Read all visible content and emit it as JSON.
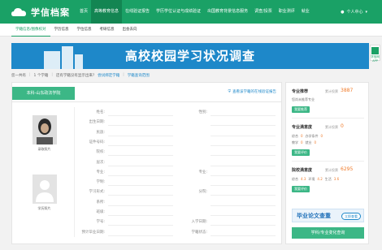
{
  "header": {
    "title": "学信档案",
    "nav": [
      "首页",
      "高等教育信息",
      "在线验证报告",
      "学历学位认证与成绩验证",
      "出国教育背景信息服务",
      "调查/投票",
      "职业测评",
      "就业"
    ],
    "active_index": 1,
    "user_label": "个人中心"
  },
  "subnav": {
    "items": [
      "学籍信息/图像校对",
      "学历信息",
      "学位信息",
      "考研信息",
      "出会去向"
    ],
    "active_index": 0
  },
  "side_badge": "学信网APP",
  "banner": {
    "title": "高校校园学习状况调查"
  },
  "crumbs": {
    "total": "您一共有",
    "count": "1 个学籍",
    "question": "还有学籍没有显示出来?",
    "link1": "尝试绑定学籍",
    "link2": "学籍查询范围"
  },
  "main": {
    "tab_label": "本科-山东政法学院",
    "help_link": "查看该学籍的在线验证报告",
    "photo_captions": [
      "录取照片",
      "学历照片"
    ],
    "fields_left": [
      "姓名:",
      "出生日期:",
      "民族:",
      "证件号码:",
      "院校:",
      "层次:",
      "专业:",
      "学制:",
      "学习形式:",
      "系所:",
      "班级:",
      "学号:",
      "预计毕业日期:"
    ],
    "fields_right": [
      "性别:",
      "",
      "",
      "",
      "",
      "",
      "专业:",
      "",
      "分院:",
      "",
      "",
      "入学日期:",
      "学籍状态:"
    ]
  },
  "sidebar": {
    "block1": {
      "head": "专业推荐",
      "sub": "累计投票",
      "num": "3887",
      "text": "您尚未推荐专业",
      "btn": "我要推荐"
    },
    "block2": {
      "head": "专业满意度",
      "sub": "累计投票",
      "num": "0",
      "row1": [
        "综合",
        "0",
        "办学条件",
        "0"
      ],
      "row2": [
        "教学",
        "0",
        "就业",
        "0"
      ],
      "btn": "我要评价"
    },
    "block3": {
      "head": "院校满意度",
      "sub": "累计投票",
      "num": "6295",
      "row1": [
        "综合",
        "4.3",
        "环境",
        "4.2",
        "生活",
        "3.6"
      ],
      "btn": "我要评价"
    },
    "ad": {
      "title": "毕业论文查重",
      "btn": "立即查看"
    },
    "big_button": "学科/专业变化查询"
  }
}
